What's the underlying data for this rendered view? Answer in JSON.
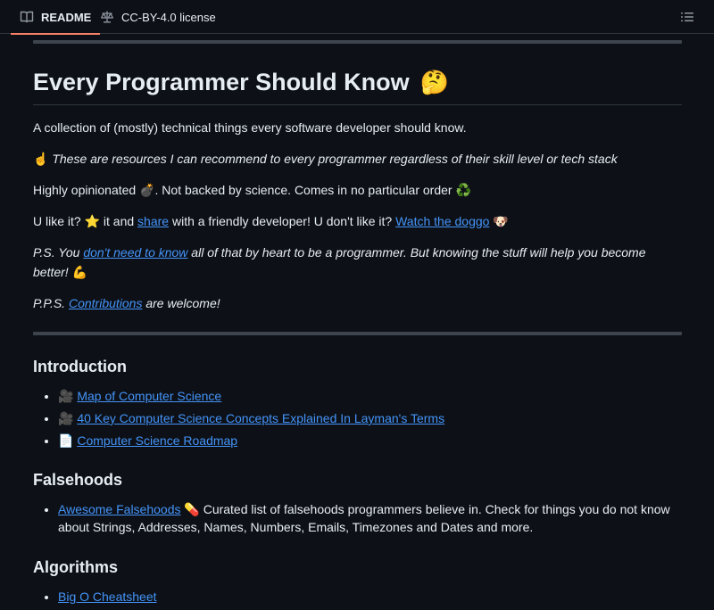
{
  "tabs": {
    "readme_label": "README",
    "license_label": "CC-BY-4.0 license"
  },
  "title": {
    "text": "Every Programmer Should Know",
    "emoji": "🤔"
  },
  "paragraphs": {
    "p1": "A collection of (mostly) technical things every software developer should know.",
    "p2_emoji": "☝️",
    "p2_text": " These are resources I can recommend to every programmer regardless of their skill level or tech stack",
    "p3_a": "Highly opinionated ",
    "p3_emoji1": "💣",
    "p3_b": ". Not backed by science. Comes in no particular order ",
    "p3_emoji2": "♻️",
    "p4_a": "U like it? ",
    "p4_star": "⭐",
    "p4_b": " it and ",
    "p4_link1": "share",
    "p4_c": " with a friendly developer! U don't like it? ",
    "p4_link2": "Watch the doggo",
    "p4_emoji": "🐶",
    "p5_a": "P.S. You ",
    "p5_link": "don't need to know",
    "p5_b": " all of that by heart to be a programmer. But knowing the stuff will help you become better! ",
    "p5_emoji": "💪",
    "p6_a": "P.P.S. ",
    "p6_link": "Contributions",
    "p6_b": " are welcome!"
  },
  "sections": {
    "introduction": {
      "heading": "Introduction",
      "items": [
        {
          "icon": "🎥",
          "link": "Map of Computer Science"
        },
        {
          "icon": "🎥",
          "link": "40 Key Computer Science Concepts Explained In Layman's Terms"
        },
        {
          "icon": "📄",
          "link": "Computer Science Roadmap"
        }
      ]
    },
    "falsehoods": {
      "heading": "Falsehoods",
      "items": [
        {
          "link": "Awesome Falsehoods",
          "icon": "💊",
          "text": " Curated list of falsehoods programmers believe in. Check for things you do not know about Strings, Addresses, Names, Numbers, Emails, Timezones and Dates and more."
        }
      ]
    },
    "algorithms": {
      "heading": "Algorithms",
      "items": [
        {
          "link": "Big O Cheatsheet"
        }
      ]
    }
  },
  "icons": {
    "readme": "book-icon",
    "license": "scale-icon",
    "toc": "list-icon"
  },
  "colors": {
    "background": "#0d1117",
    "link": "#4493f8",
    "tab_underline": "#f78166",
    "divider": "#3d444d"
  }
}
